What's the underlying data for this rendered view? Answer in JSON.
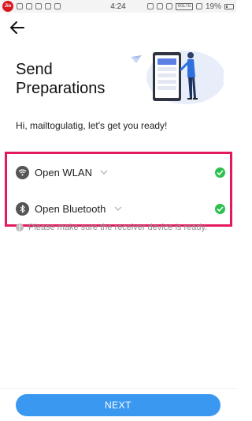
{
  "status_bar": {
    "carrier_badge": "Jio",
    "time": "4:24",
    "network_tag": "VoLTE",
    "battery": "19%"
  },
  "header": {
    "back_icon": "arrow-left-icon",
    "title": "Send Preparations"
  },
  "greeting": "Hi, mailtogulatig, let's get you ready!",
  "checks": [
    {
      "label": "Open WLAN",
      "icon": "wifi-icon",
      "status": "done"
    },
    {
      "label": "Open Bluetooth",
      "icon": "bluetooth-icon",
      "status": "done"
    }
  ],
  "note": "Please make sure the receiver device is ready.",
  "footer": {
    "next_label": "NEXT"
  },
  "colors": {
    "accent": "#3a98f1",
    "highlight_border": "#e5195d",
    "success": "#2dc04f",
    "muted_text": "#8d8d8d"
  }
}
